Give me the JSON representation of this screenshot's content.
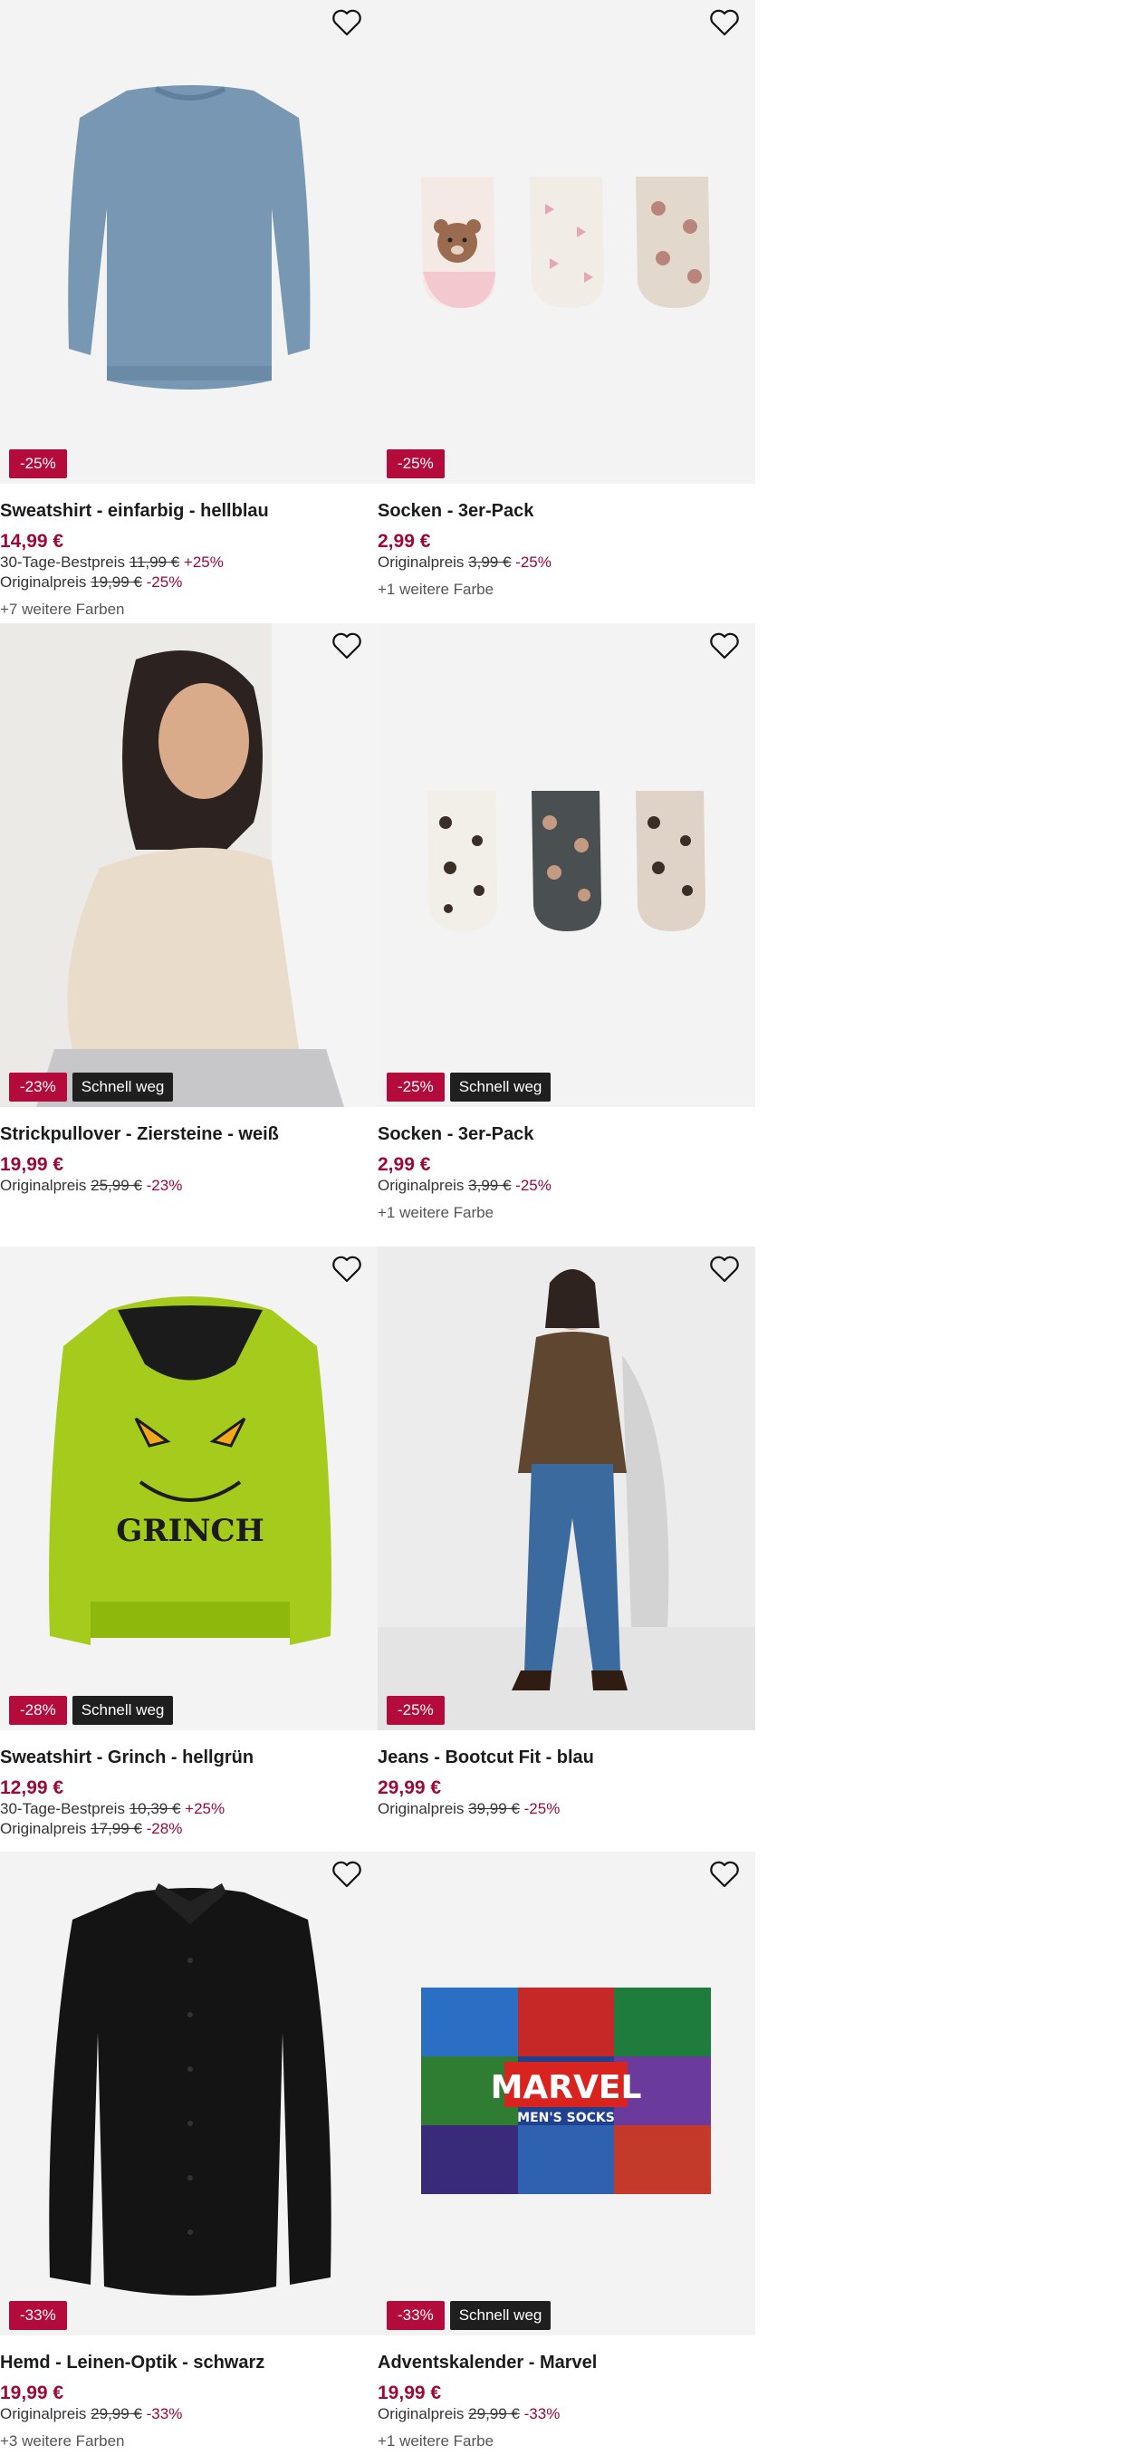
{
  "colors": {
    "sale_badge": "#b30b3b",
    "price": "#9b0a37",
    "fast_badge": "#1f1f1f",
    "image_bg": "#f3f3f3"
  },
  "fast_label": "Schnell weg",
  "products": [
    {
      "title": "Sweatshirt - einfarbig - hellblau",
      "price": "14,99 €",
      "discount_badge": "-25%",
      "fast": false,
      "line1": {
        "label": "30-Tage-Bestpreis",
        "old": "11,99 €",
        "pct": "+25%"
      },
      "line2": {
        "label": "Originalpreis",
        "old": "19,99 €",
        "pct": "-25%"
      },
      "colors": "+7 weitere Farben",
      "image": "blue-sweatshirt"
    },
    {
      "title": "Socken - 3er-Pack",
      "price": "2,99 €",
      "discount_badge": "-25%",
      "fast": false,
      "line1": {
        "label": "Originalpreis",
        "old": "3,99 €",
        "pct": "-25%"
      },
      "colors": "+1 weitere Farbe",
      "image": "bear-socks"
    },
    {
      "title": "Strickpullover - Ziersteine - weiß",
      "price": "19,99 €",
      "discount_badge": "-23%",
      "fast": true,
      "line1": {
        "label": "Originalpreis",
        "old": "25,99 €",
        "pct": "-23%"
      },
      "image": "woman-knit-sweater"
    },
    {
      "title": "Socken - 3er-Pack",
      "price": "2,99 €",
      "discount_badge": "-25%",
      "fast": true,
      "line1": {
        "label": "Originalpreis",
        "old": "3,99 €",
        "pct": "-25%"
      },
      "colors": "+1 weitere Farbe",
      "image": "leopard-socks"
    },
    {
      "title": "Sweatshirt - Grinch - hellgrün",
      "price": "12,99 €",
      "discount_badge": "-28%",
      "fast": true,
      "line1": {
        "label": "30-Tage-Bestpreis",
        "old": "10,39 €",
        "pct": "+25%"
      },
      "line2": {
        "label": "Originalpreis",
        "old": "17,99 €",
        "pct": "-28%"
      },
      "image": "grinch-hoodie",
      "image_text": "GRINCH"
    },
    {
      "title": "Jeans - Bootcut Fit - blau",
      "price": "29,99 €",
      "discount_badge": "-25%",
      "fast": false,
      "line1": {
        "label": "Originalpreis",
        "old": "39,99 €",
        "pct": "-25%"
      },
      "image": "woman-bootcut-jeans"
    },
    {
      "title": "Hemd - Leinen-Optik - schwarz",
      "price": "19,99 €",
      "discount_badge": "-33%",
      "fast": false,
      "line1": {
        "label": "Originalpreis",
        "old": "29,99 €",
        "pct": "-33%"
      },
      "colors": "+3 weitere Farben",
      "image": "black-shirt"
    },
    {
      "title": "Adventskalender - Marvel",
      "price": "19,99 €",
      "discount_badge": "-33%",
      "fast": true,
      "line1": {
        "label": "Originalpreis",
        "old": "29,99 €",
        "pct": "-33%"
      },
      "colors": "+1 weitere Farbe",
      "image": "marvel-advent-calendar",
      "image_text": "MARVEL",
      "image_subtext": "MEN'S SOCKS"
    }
  ]
}
